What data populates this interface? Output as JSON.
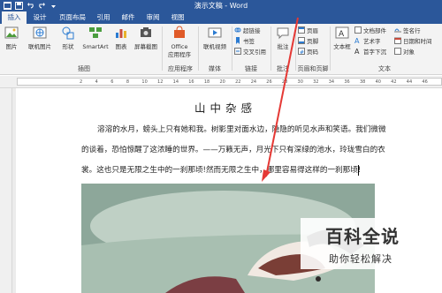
{
  "window": {
    "title": "演示文稿 - Word",
    "accent": "#2b579a"
  },
  "tabs": [
    {
      "label": "插入",
      "active": true
    },
    {
      "label": "设计"
    },
    {
      "label": "页面布局"
    },
    {
      "label": "引用"
    },
    {
      "label": "邮件"
    },
    {
      "label": "审阅"
    },
    {
      "label": "视图"
    }
  ],
  "ribbon": {
    "illustrations": {
      "picture": "图片",
      "online_picture": "联机图片",
      "shapes": "形状",
      "smartart": "SmartArt",
      "chart": "图表",
      "screenshot": "屏幕截图",
      "label": "插图"
    },
    "apps": {
      "office_line1": "Office",
      "office_line2": "应用程序",
      "label": "应用程序"
    },
    "media": {
      "online_video": "联机视频",
      "label": "媒体"
    },
    "links": {
      "hyperlink": "超链接",
      "bookmark": "书签",
      "cross_ref": "交叉引用",
      "label": "链接"
    },
    "comments": {
      "comment": "批注",
      "label": "批注"
    },
    "header_footer": {
      "header": "页眉",
      "footer": "页脚",
      "page_number": "页码",
      "label": "页眉和页脚"
    },
    "text": {
      "textbox_line1": "文本框",
      "quick_parts": "文档部件",
      "wordart": "艺术字",
      "dropcap": "首字下沉",
      "signature": "签名行",
      "datetime": "日期和时间",
      "object": "对象",
      "label": "文本"
    }
  },
  "ruler": {
    "numbers": [
      "2",
      "4",
      "6",
      "8",
      "10",
      "12",
      "14",
      "16",
      "18",
      "20",
      "22",
      "24",
      "26",
      "28",
      "30",
      "32",
      "34",
      "36",
      "38",
      "40",
      "42",
      "44",
      "46"
    ]
  },
  "document": {
    "title": "山中杂感",
    "paragraphs": [
      "溶溶的水月，螃头上只有她和我。树影里对面水边，隐隐的听见水声和笑语。我们微微",
      "的谈着，恐怕惊醒了这浓睡的世界。——万籁无声，月光下只有深绿的池水，玲珑雪白的衣",
      "裳。这也只是无限之生中的一刹那顷!然而无限之生中，哪里容易得这样的一刹那顷!"
    ]
  },
  "watermark": {
    "brand": "百科全说",
    "tagline": "助你轻松解决"
  }
}
